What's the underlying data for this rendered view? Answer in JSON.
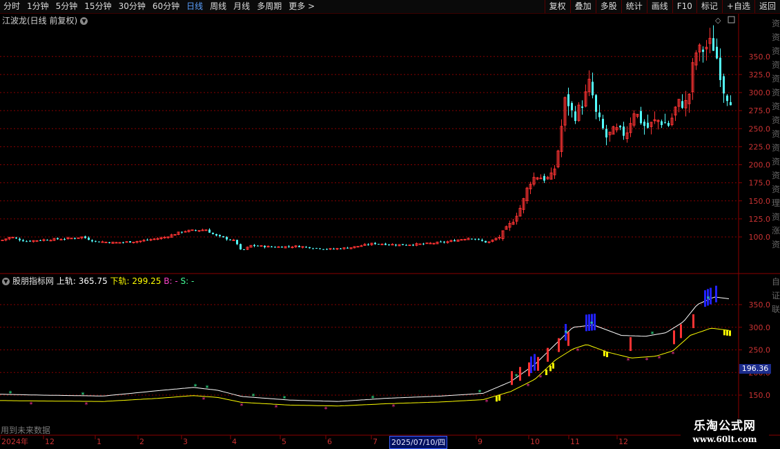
{
  "toolbar": {
    "periods": [
      "分时",
      "1分钟",
      "5分钟",
      "15分钟",
      "30分钟",
      "60分钟",
      "日线",
      "周线",
      "月线",
      "多周期",
      "更多 >"
    ],
    "active_period": "日线",
    "tools": [
      "复权",
      "叠加",
      "多股",
      "统计",
      "画线",
      "F10",
      "标记",
      "+自选",
      "返回"
    ]
  },
  "main_chart": {
    "title": "江波龙(日线 前复权)",
    "y_ticks": [
      100.0,
      125.0,
      150.0,
      175.0,
      200.0,
      225.0,
      250.0,
      275.0,
      300.0,
      325.0,
      350.0
    ]
  },
  "indicator": {
    "name": "股朋指标网",
    "upper_label": "上轨:",
    "upper_value": "365.75",
    "lower_label": "下轨:",
    "lower_value": "299.25",
    "b_label": "B:",
    "b_value": "-",
    "s_label": "S:",
    "s_value": "-",
    "y_ticks": [
      150.0,
      200.0,
      250.0,
      300.0,
      350.0
    ],
    "last_value": "196.36",
    "future_note": "用到未来数据"
  },
  "x_axis": {
    "labels": [
      "2024年",
      "12",
      "1",
      "2",
      "3",
      "4",
      "5",
      "6",
      "7",
      "8",
      "9",
      "10",
      "11",
      "12"
    ],
    "cursor_date": "2025/07/10/四"
  },
  "side_panel": {
    "top_chars": "资资资资资资资资资资资资资理资涨资",
    "bottom_chars": "自证联"
  },
  "watermark": {
    "name": "乐淘公式网",
    "url": "www.60lt.com"
  },
  "colors": {
    "up": "#ff3333",
    "down": "#54ffff",
    "grid": "#8b0000",
    "upper_band": "#ffffff",
    "lower_band": "#ffff00",
    "buy_signal": "#ff3399",
    "sell_signal": "#33ff99",
    "blue_bar": "#2222ff",
    "active_tab": "#5aa0ff"
  },
  "chart_data": {
    "type": "candlestick",
    "note_series": [
      {
        "name": "上轨",
        "last": 365.75
      },
      {
        "name": "下轨",
        "last": 299.25
      }
    ],
    "price_anchors": [
      {
        "x": 0,
        "close": 95
      },
      {
        "x": 14,
        "close": 100
      },
      {
        "x": 35,
        "close": 94
      },
      {
        "x": 62,
        "close": 96
      },
      {
        "x": 82,
        "close": 97
      },
      {
        "x": 100,
        "close": 98
      },
      {
        "x": 118,
        "close": 100
      },
      {
        "x": 135,
        "close": 94
      },
      {
        "x": 165,
        "close": 92
      },
      {
        "x": 200,
        "close": 94
      },
      {
        "x": 235,
        "close": 99
      },
      {
        "x": 265,
        "close": 108
      },
      {
        "x": 297,
        "close": 110
      },
      {
        "x": 310,
        "close": 102
      },
      {
        "x": 340,
        "close": 94
      },
      {
        "x": 348,
        "close": 80
      },
      {
        "x": 362,
        "close": 88
      },
      {
        "x": 395,
        "close": 86
      },
      {
        "x": 430,
        "close": 87
      },
      {
        "x": 475,
        "close": 83
      },
      {
        "x": 505,
        "close": 85
      },
      {
        "x": 540,
        "close": 91
      },
      {
        "x": 575,
        "close": 89
      },
      {
        "x": 610,
        "close": 90
      },
      {
        "x": 645,
        "close": 93
      },
      {
        "x": 680,
        "close": 99
      },
      {
        "x": 705,
        "close": 92
      },
      {
        "x": 722,
        "close": 100
      },
      {
        "x": 740,
        "close": 120
      },
      {
        "x": 755,
        "close": 145
      },
      {
        "x": 765,
        "close": 175
      },
      {
        "x": 775,
        "close": 185
      },
      {
        "x": 790,
        "close": 180
      },
      {
        "x": 800,
        "close": 185
      },
      {
        "x": 808,
        "close": 225
      },
      {
        "x": 818,
        "close": 295
      },
      {
        "x": 830,
        "close": 265
      },
      {
        "x": 845,
        "close": 290
      },
      {
        "x": 853,
        "close": 315
      },
      {
        "x": 862,
        "close": 270
      },
      {
        "x": 877,
        "close": 238
      },
      {
        "x": 890,
        "close": 248
      },
      {
        "x": 905,
        "close": 242
      },
      {
        "x": 917,
        "close": 275
      },
      {
        "x": 935,
        "close": 250
      },
      {
        "x": 950,
        "close": 262
      },
      {
        "x": 968,
        "close": 255
      },
      {
        "x": 980,
        "close": 285
      },
      {
        "x": 995,
        "close": 285
      },
      {
        "x": 1005,
        "close": 355
      },
      {
        "x": 1018,
        "close": 360
      },
      {
        "x": 1030,
        "close": 370
      },
      {
        "x": 1038,
        "close": 345
      },
      {
        "x": 1048,
        "close": 300
      },
      {
        "x": 1058,
        "close": 290
      }
    ],
    "upper_band": [
      {
        "x": 0,
        "v": 152
      },
      {
        "x": 60,
        "v": 150
      },
      {
        "x": 150,
        "v": 148
      },
      {
        "x": 230,
        "v": 160
      },
      {
        "x": 280,
        "v": 167
      },
      {
        "x": 315,
        "v": 161
      },
      {
        "x": 350,
        "v": 147
      },
      {
        "x": 420,
        "v": 139
      },
      {
        "x": 490,
        "v": 136
      },
      {
        "x": 560,
        "v": 143
      },
      {
        "x": 640,
        "v": 148
      },
      {
        "x": 700,
        "v": 154
      },
      {
        "x": 740,
        "v": 180
      },
      {
        "x": 775,
        "v": 218
      },
      {
        "x": 805,
        "v": 263
      },
      {
        "x": 830,
        "v": 300
      },
      {
        "x": 860,
        "v": 305
      },
      {
        "x": 900,
        "v": 282
      },
      {
        "x": 935,
        "v": 280
      },
      {
        "x": 965,
        "v": 288
      },
      {
        "x": 990,
        "v": 312
      },
      {
        "x": 1010,
        "v": 350
      },
      {
        "x": 1035,
        "v": 367
      },
      {
        "x": 1056,
        "v": 363
      }
    ],
    "lower_band": [
      {
        "x": 0,
        "v": 138
      },
      {
        "x": 60,
        "v": 137
      },
      {
        "x": 150,
        "v": 136
      },
      {
        "x": 230,
        "v": 143
      },
      {
        "x": 280,
        "v": 149
      },
      {
        "x": 315,
        "v": 145
      },
      {
        "x": 350,
        "v": 134
      },
      {
        "x": 420,
        "v": 128
      },
      {
        "x": 490,
        "v": 126
      },
      {
        "x": 560,
        "v": 131
      },
      {
        "x": 640,
        "v": 135
      },
      {
        "x": 700,
        "v": 140
      },
      {
        "x": 740,
        "v": 158
      },
      {
        "x": 775,
        "v": 185
      },
      {
        "x": 805,
        "v": 228
      },
      {
        "x": 830,
        "v": 252
      },
      {
        "x": 850,
        "v": 262
      },
      {
        "x": 880,
        "v": 245
      },
      {
        "x": 915,
        "v": 232
      },
      {
        "x": 950,
        "v": 236
      },
      {
        "x": 975,
        "v": 248
      },
      {
        "x": 1000,
        "v": 282
      },
      {
        "x": 1030,
        "v": 298
      },
      {
        "x": 1056,
        "v": 293
      }
    ]
  }
}
